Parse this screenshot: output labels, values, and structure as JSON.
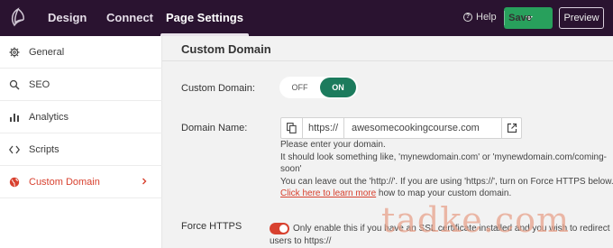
{
  "topbar": {
    "tabs": [
      "Design",
      "Connect",
      "Page Settings"
    ],
    "help_label": "Help",
    "save_label": "Save",
    "preview_label": "Preview"
  },
  "sidebar": {
    "items": [
      {
        "label": "General",
        "icon": "gear-icon"
      },
      {
        "label": "SEO",
        "icon": "search-icon"
      },
      {
        "label": "Analytics",
        "icon": "bar-chart-icon"
      },
      {
        "label": "Scripts",
        "icon": "code-icon"
      },
      {
        "label": "Custom Domain",
        "icon": "globe-icon",
        "active": true
      }
    ]
  },
  "main": {
    "section_title": "Custom Domain",
    "custom_domain": {
      "label": "Custom Domain:",
      "off_label": "OFF",
      "on_label": "ON",
      "value": "ON"
    },
    "domain_name": {
      "label": "Domain Name:",
      "prefix": "https://",
      "value": "awesomecookingcourse.com"
    },
    "help": {
      "line1": "Please enter your domain.",
      "line2": "It should look something like, 'mynewdomain.com' or 'mynewdomain.com/coming-",
      "line3": "soon'",
      "line4": "You can leave out the 'http://'. If you are using 'https://', turn on Force HTTPS below.",
      "link": "Click here to learn more",
      "line5_rest": " how to map your custom domain."
    },
    "force_https": {
      "label": "Force HTTPS",
      "note_line1": "Only enable this if you have an SSL certificate installed and you wish to redirect",
      "note_line2": "users to https://"
    }
  },
  "watermark": "tadke.com",
  "colors": {
    "topbar": "#2a1330",
    "accent_green": "#28a05c",
    "toggle_on": "#1c7b5d",
    "active_red": "#d8412f"
  }
}
